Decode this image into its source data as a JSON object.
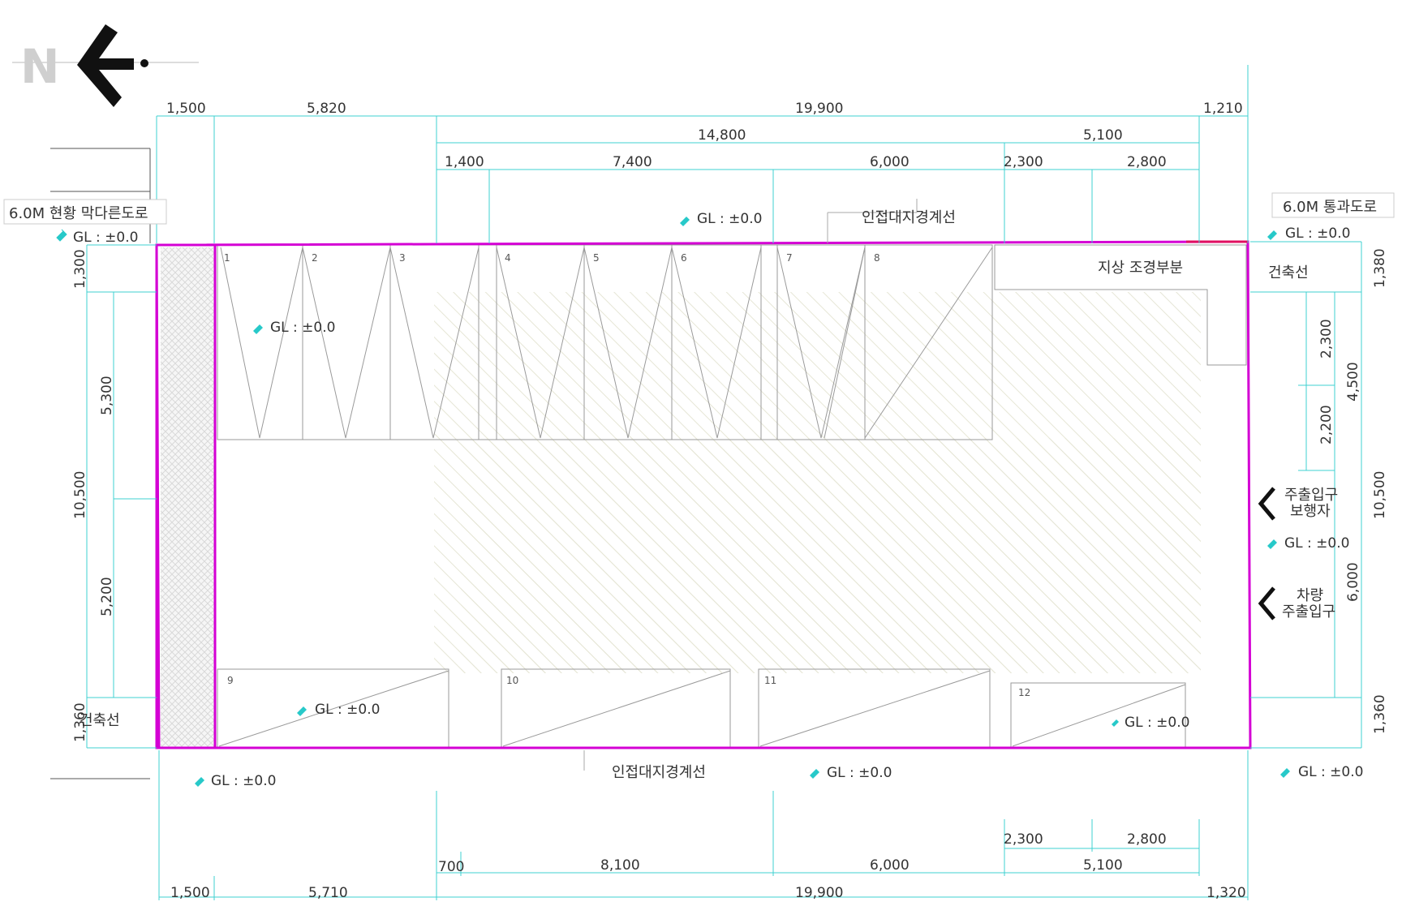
{
  "colors": {
    "boundary": "#d400d4",
    "dimension": "#3fd0d0",
    "hatch": "#e4e4d4",
    "gl_marker": "#27c9c9"
  },
  "north_label": "N",
  "dims": {
    "top_row1": [
      "1,500",
      "5,820",
      "19,900",
      "1,210"
    ],
    "top_row2": [
      "14,800",
      "5,100"
    ],
    "top_row3": [
      "1,400",
      "7,400",
      "6,000",
      "2,300",
      "2,800"
    ],
    "bottom_row1": [
      "2,300",
      "2,800"
    ],
    "bottom_row2": [
      "700",
      "8,100",
      "6,000",
      "5,100"
    ],
    "bottom_row3": [
      "1,500",
      "5,710",
      "19,900",
      "1,320"
    ],
    "left_outer": [
      "1,300",
      "10,500",
      "1,360"
    ],
    "left_inner": [
      "5,300",
      "5,200"
    ],
    "right_outer": [
      "1,380",
      "10,500",
      "1,360"
    ],
    "right_inner": [
      "2,300",
      "2,200",
      "4,500",
      "6,000"
    ]
  },
  "labels": {
    "left_road": "6.0M 현황 막다른도로",
    "right_road": "6.0M 통과도로",
    "boundary_top": "인접대지경계선",
    "boundary_bottom": "인접대지경계선",
    "building_line_right": "건축선",
    "building_line_left": "건축선",
    "landscape": "지상 조경부분",
    "main_entrance_line1": "주출입구",
    "main_entrance_line2": "보행자",
    "vehicle_entrance_line1": "차량",
    "vehicle_entrance_line2": "주출입구"
  },
  "gl": "GL : ±0.0",
  "parking_numbers": [
    "1",
    "2",
    "3",
    "4",
    "5",
    "6",
    "7",
    "8",
    "9",
    "10",
    "11",
    "12"
  ]
}
